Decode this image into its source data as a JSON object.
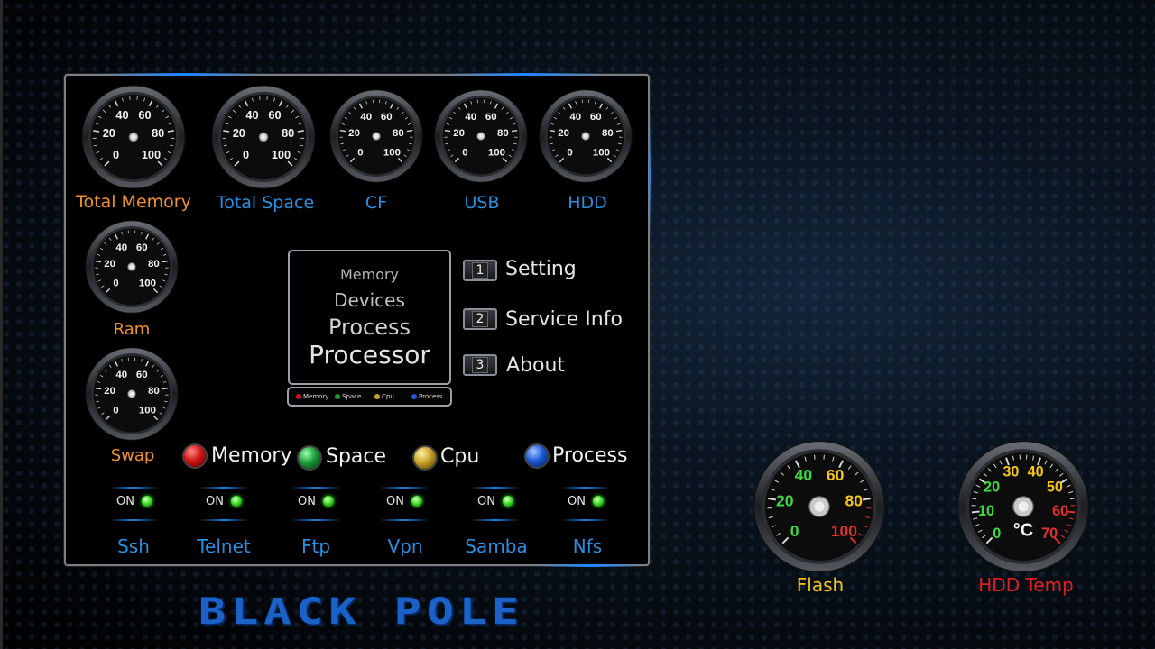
{
  "gauges_top": [
    {
      "label": "Total Memory",
      "color": "#f0912f",
      "ticks": [
        "0",
        "20",
        "40",
        "60",
        "80",
        "100"
      ]
    },
    {
      "label": "Total Space",
      "color": "#2a8fe0",
      "ticks": [
        "0",
        "20",
        "40",
        "60",
        "80",
        "100"
      ]
    },
    {
      "label": "CF",
      "color": "#2a8fe0",
      "ticks": [
        "0",
        "20",
        "40",
        "60",
        "80",
        "100"
      ]
    },
    {
      "label": "USB",
      "color": "#2a8fe0",
      "ticks": [
        "0",
        "20",
        "40",
        "60",
        "80",
        "100"
      ]
    },
    {
      "label": "HDD",
      "color": "#2a8fe0",
      "ticks": [
        "0",
        "20",
        "40",
        "60",
        "80",
        "100"
      ]
    }
  ],
  "gauges_left": [
    {
      "label": "Ram",
      "color": "#f0912f"
    },
    {
      "label": "Swap",
      "color": "#f0912f"
    }
  ],
  "info_box": {
    "line1": "Memory",
    "line2": "Devices",
    "line3": "Process",
    "line4": "Processor"
  },
  "mini_legend": [
    "Memory",
    "Space",
    "Cpu",
    "Process"
  ],
  "menu": [
    {
      "number": "1",
      "label": "Setting"
    },
    {
      "number": "2",
      "label": "Service Info"
    },
    {
      "number": "3",
      "label": "About"
    }
  ],
  "legend": [
    {
      "label": "Memory",
      "color": "#d11414"
    },
    {
      "label": "Space",
      "color": "#1c9a3a"
    },
    {
      "label": "Cpu",
      "color": "#c9a125"
    },
    {
      "label": "Process",
      "color": "#1c5ad6"
    }
  ],
  "services": [
    {
      "name": "Ssh",
      "state": "ON"
    },
    {
      "name": "Telnet",
      "state": "ON"
    },
    {
      "name": "Ftp",
      "state": "ON"
    },
    {
      "name": "Vpn",
      "state": "ON"
    },
    {
      "name": "Samba",
      "state": "ON"
    },
    {
      "name": "Nfs",
      "state": "ON"
    }
  ],
  "flash_gauge": {
    "label": "Flash",
    "color": "#f5c518",
    "ticks": [
      "0",
      "20",
      "40",
      "60",
      "80",
      "100"
    ]
  },
  "temp_gauge": {
    "label": "HDD Temp",
    "color": "#e02020",
    "unit": "°C",
    "ticks": [
      "0",
      "10",
      "20",
      "30",
      "40",
      "50",
      "60",
      "70"
    ]
  },
  "brand": "BLACK POLE",
  "icons": {
    "gauge": "gauge-icon",
    "led": "led-icon",
    "ball": "indicator-ball-icon"
  }
}
